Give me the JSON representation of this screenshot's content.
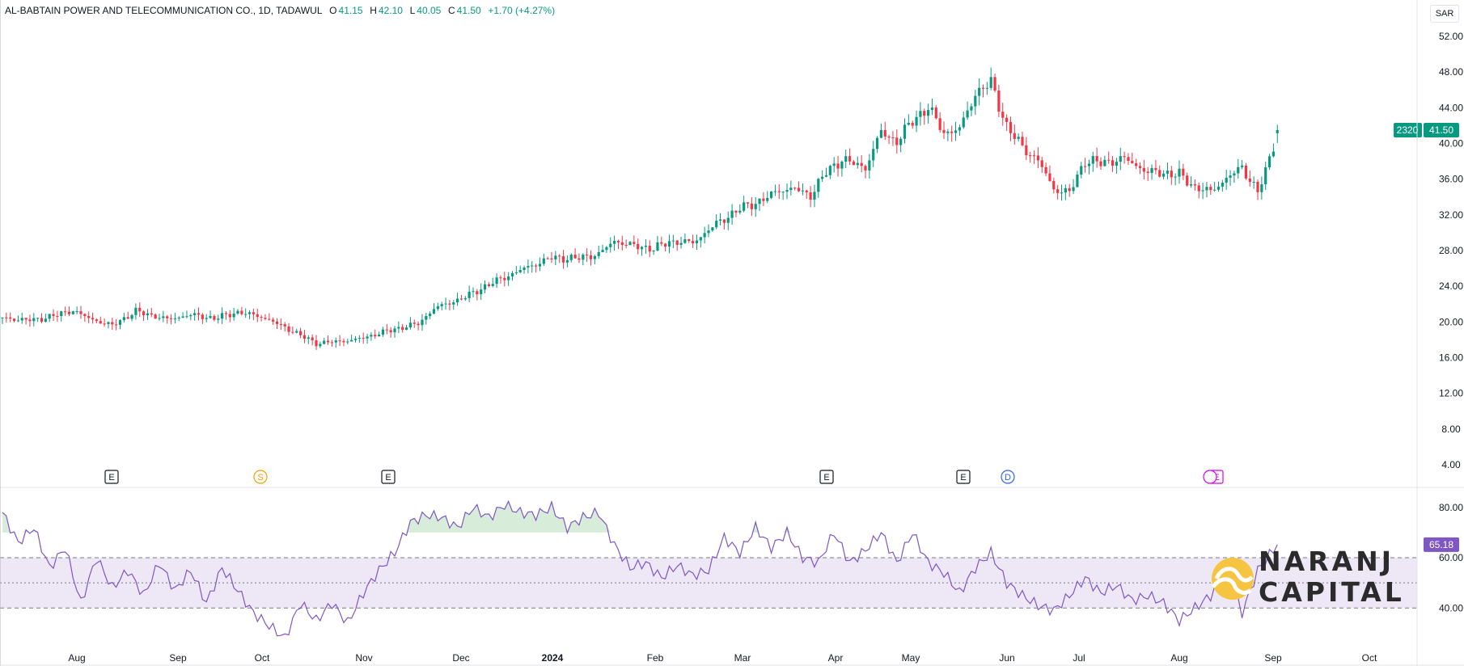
{
  "header": {
    "symbol": "AL-BABTAIN POWER AND TELECOMMUNICATION CO., 1D, TADAWUL",
    "open_label": "O",
    "open": "41.15",
    "high_label": "H",
    "high": "42.10",
    "low_label": "L",
    "low": "40.05",
    "close_label": "C",
    "close": "41.50",
    "change": "+1.70 (+4.27%)"
  },
  "currency_button": "SAR",
  "price_tags": {
    "countdown": "2320",
    "last_price": "41.50",
    "rsi_value": "65.18"
  },
  "logo": {
    "line1": "NARANJ",
    "line2": "CAPITAL"
  },
  "colors": {
    "up": "#089981",
    "down": "#f23645",
    "rsi_line": "#7e57c2",
    "rsi_band": "#ede7f6",
    "logo_mark": "#f5c542"
  },
  "chart_data": [
    {
      "type": "candlestick",
      "y_ticks": [
        "52.00",
        "48.00",
        "44.00",
        "40.00",
        "36.00",
        "32.00",
        "28.00",
        "24.00",
        "20.00",
        "16.00",
        "12.00",
        "8.00",
        "4.00"
      ],
      "ylim": [
        4,
        52
      ],
      "x_tick_labels": [
        "Aug",
        "Sep",
        "Oct",
        "Nov",
        "Dec",
        "2024",
        "Feb",
        "Mar",
        "Apr",
        "May",
        "Jun",
        "Jul",
        "Aug",
        "Sep",
        "Oct"
      ],
      "close_path": [
        [
          0,
          20.4
        ],
        [
          8,
          20.2
        ],
        [
          14,
          20.8
        ],
        [
          18,
          21.3
        ],
        [
          22,
          20.4
        ],
        [
          28,
          19.6
        ],
        [
          34,
          21.2
        ],
        [
          42,
          20.3
        ],
        [
          48,
          20.8
        ],
        [
          54,
          20.4
        ],
        [
          60,
          21.1
        ],
        [
          66,
          20.6
        ],
        [
          72,
          19.4
        ],
        [
          80,
          17.6
        ],
        [
          90,
          18.0
        ],
        [
          100,
          19.2
        ],
        [
          106,
          19.8
        ],
        [
          110,
          21.5
        ],
        [
          118,
          22.8
        ],
        [
          124,
          24.2
        ],
        [
          132,
          25.8
        ],
        [
          140,
          27.2
        ],
        [
          146,
          27.1
        ],
        [
          152,
          27.6
        ],
        [
          156,
          29.1
        ],
        [
          160,
          28.6
        ],
        [
          166,
          28.2
        ],
        [
          170,
          29.0
        ],
        [
          176,
          28.9
        ],
        [
          182,
          31.0
        ],
        [
          188,
          32.7
        ],
        [
          194,
          33.7
        ],
        [
          198,
          34.8
        ],
        [
          202,
          34.9
        ],
        [
          206,
          34.2
        ],
        [
          210,
          36.8
        ],
        [
          214,
          38.2
        ],
        [
          220,
          37.3
        ],
        [
          224,
          41.3
        ],
        [
          228,
          40.2
        ],
        [
          232,
          42.6
        ],
        [
          236,
          44.0
        ],
        [
          240,
          41.2
        ],
        [
          244,
          41.6
        ],
        [
          248,
          45.6
        ],
        [
          252,
          46.8
        ],
        [
          256,
          41.9
        ],
        [
          260,
          39.6
        ],
        [
          264,
          38.1
        ],
        [
          268,
          34.9
        ],
        [
          272,
          34.5
        ],
        [
          276,
          38.1
        ],
        [
          280,
          37.8
        ],
        [
          286,
          38.3
        ],
        [
          292,
          36.8
        ],
        [
          296,
          36.7
        ],
        [
          300,
          36.5
        ],
        [
          304,
          35.1
        ],
        [
          308,
          34.6
        ],
        [
          312,
          36.1
        ],
        [
          316,
          37.3
        ],
        [
          320,
          34.6
        ],
        [
          322,
          36.8
        ],
        [
          324,
          39.8
        ],
        [
          325,
          41.5
        ]
      ],
      "last_bar": {
        "open": 41.15,
        "high": 42.1,
        "low": 40.05,
        "close": 41.5
      },
      "event_markers": [
        {
          "label": "E",
          "kind": "earnings"
        },
        {
          "label": "S",
          "kind": "split"
        },
        {
          "label": "E",
          "kind": "earnings"
        },
        {
          "label": "E",
          "kind": "earnings"
        },
        {
          "label": "E",
          "kind": "earnings"
        },
        {
          "label": "D",
          "kind": "dividend"
        },
        {
          "label": "E",
          "kind": "earnings"
        }
      ]
    },
    {
      "type": "line",
      "name": "",
      "y_ticks": [
        "80.00",
        "60.00",
        "40.00"
      ],
      "ylim": [
        25,
        87
      ],
      "band": [
        40,
        60
      ],
      "midline": 50,
      "last_value": 65.18,
      "path": [
        [
          0,
          78
        ],
        [
          4,
          66
        ],
        [
          8,
          72
        ],
        [
          12,
          56
        ],
        [
          16,
          64
        ],
        [
          20,
          42
        ],
        [
          24,
          60
        ],
        [
          28,
          48
        ],
        [
          32,
          55
        ],
        [
          36,
          45
        ],
        [
          40,
          58
        ],
        [
          44,
          47
        ],
        [
          48,
          55
        ],
        [
          52,
          42
        ],
        [
          56,
          56
        ],
        [
          60,
          47
        ],
        [
          64,
          38
        ],
        [
          68,
          33
        ],
        [
          72,
          28
        ],
        [
          76,
          42
        ],
        [
          80,
          35
        ],
        [
          84,
          42
        ],
        [
          88,
          34
        ],
        [
          92,
          46
        ],
        [
          96,
          55
        ],
        [
          100,
          62
        ],
        [
          104,
          74
        ],
        [
          108,
          77
        ],
        [
          112,
          76
        ],
        [
          116,
          72
        ],
        [
          120,
          80
        ],
        [
          124,
          76
        ],
        [
          128,
          81
        ],
        [
          132,
          78
        ],
        [
          136,
          77
        ],
        [
          140,
          80
        ],
        [
          144,
          72
        ],
        [
          148,
          76
        ],
        [
          152,
          78
        ],
        [
          156,
          65
        ],
        [
          160,
          56
        ],
        [
          164,
          58
        ],
        [
          168,
          52
        ],
        [
          172,
          57
        ],
        [
          176,
          53
        ],
        [
          180,
          55
        ],
        [
          184,
          68
        ],
        [
          188,
          62
        ],
        [
          192,
          72
        ],
        [
          196,
          64
        ],
        [
          200,
          70
        ],
        [
          204,
          60
        ],
        [
          208,
          58
        ],
        [
          212,
          70
        ],
        [
          216,
          58
        ],
        [
          220,
          63
        ],
        [
          224,
          70
        ],
        [
          228,
          58
        ],
        [
          232,
          70
        ],
        [
          236,
          58
        ],
        [
          240,
          54
        ],
        [
          244,
          46
        ],
        [
          248,
          56
        ],
        [
          252,
          62
        ],
        [
          256,
          50
        ],
        [
          260,
          45
        ],
        [
          264,
          41
        ],
        [
          268,
          39
        ],
        [
          272,
          45
        ],
        [
          276,
          52
        ],
        [
          280,
          46
        ],
        [
          284,
          49
        ],
        [
          288,
          43
        ],
        [
          292,
          45
        ],
        [
          296,
          42
        ],
        [
          300,
          35
        ],
        [
          304,
          40
        ],
        [
          308,
          45
        ],
        [
          312,
          54
        ],
        [
          316,
          38
        ],
        [
          320,
          55
        ],
        [
          325,
          65.18
        ]
      ]
    }
  ]
}
